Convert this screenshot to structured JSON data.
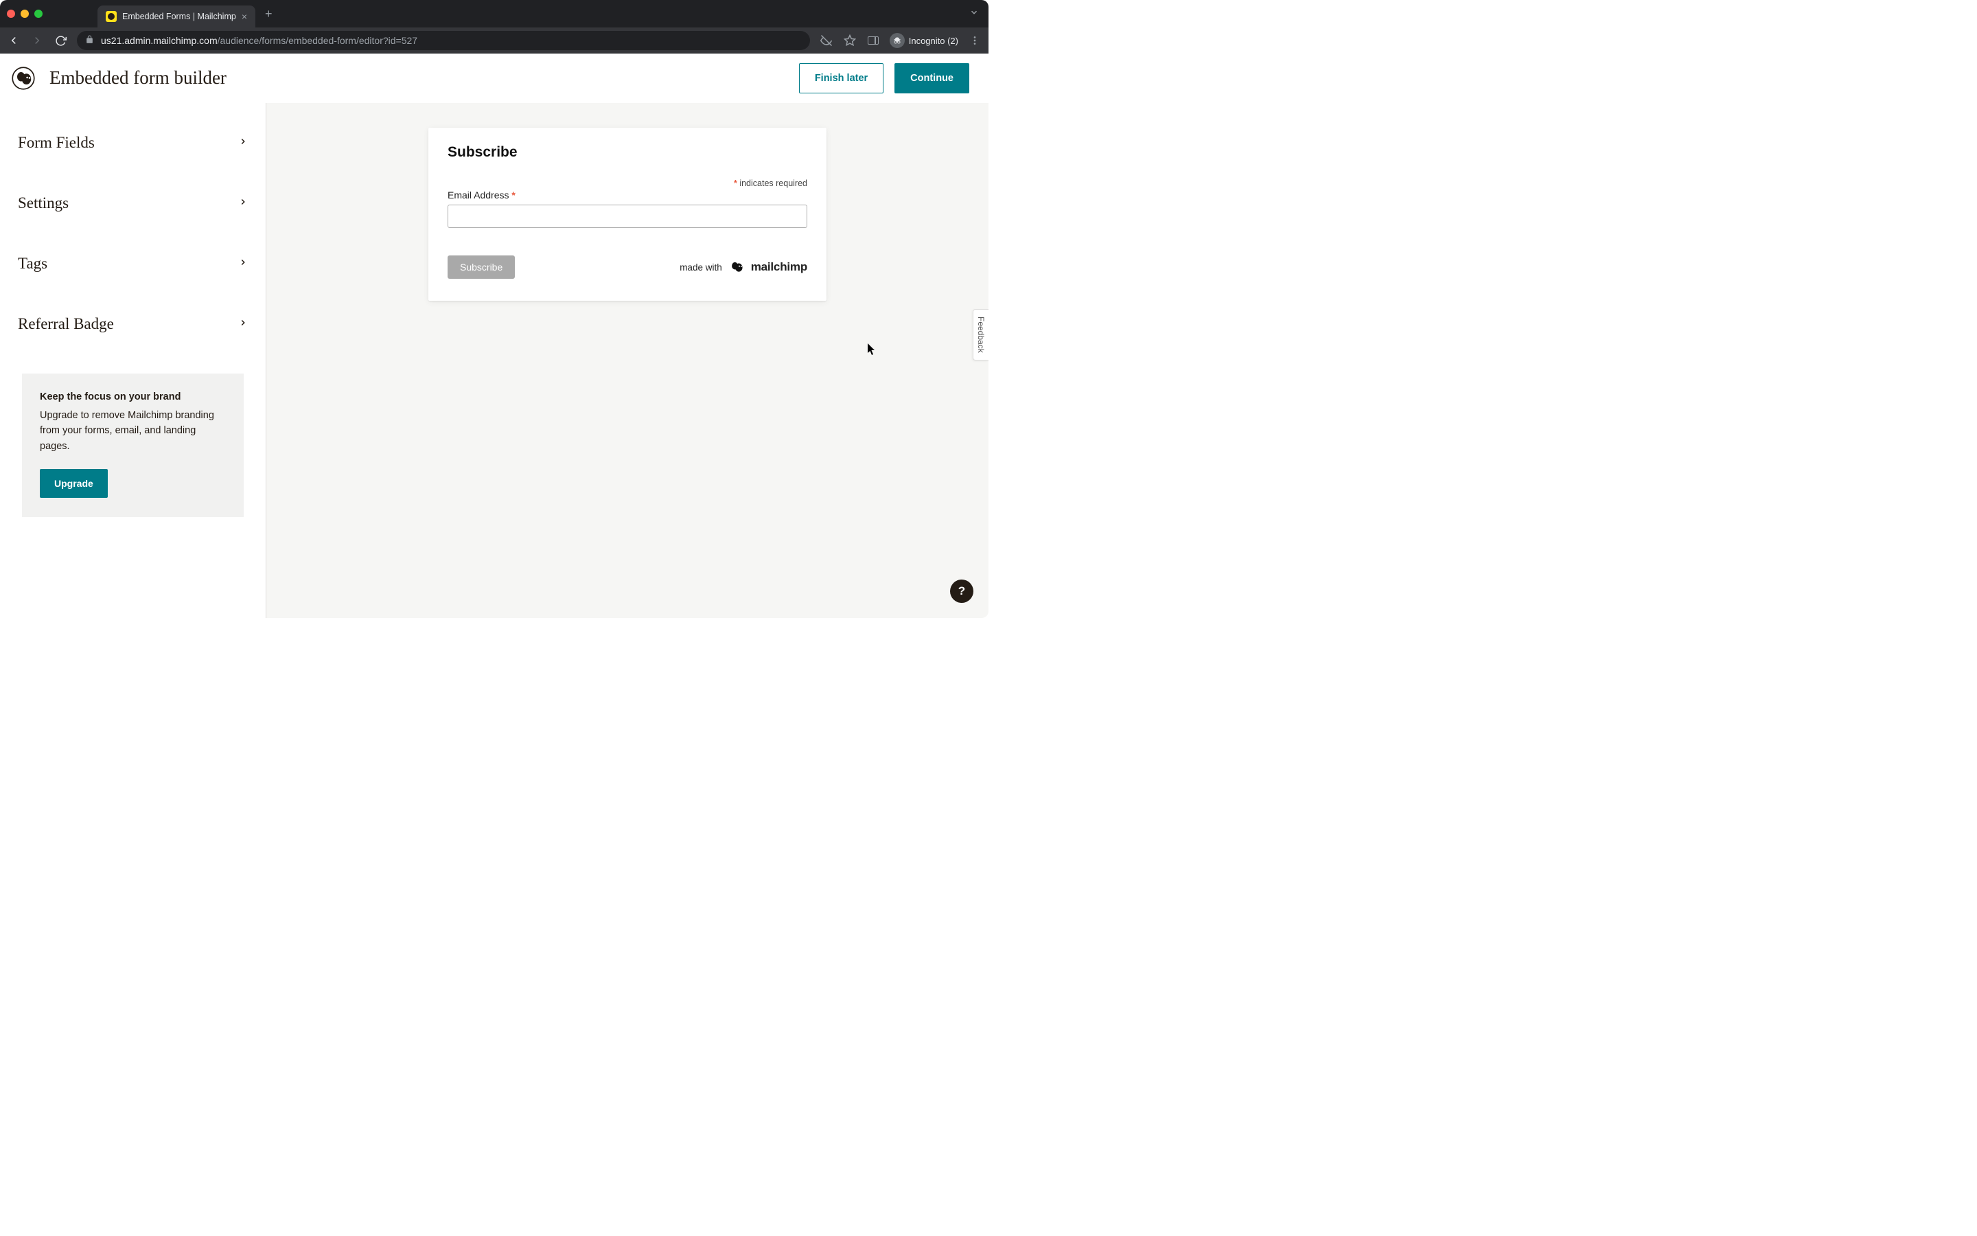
{
  "browser": {
    "tab_title": "Embedded Forms | Mailchimp",
    "url_host": "us21.admin.mailchimp.com",
    "url_path": "/audience/forms/embedded-form/editor?id=527",
    "incognito_label": "Incognito (2)"
  },
  "header": {
    "title": "Embedded form builder",
    "finish_later": "Finish later",
    "continue": "Continue"
  },
  "sidebar": {
    "items": [
      {
        "label": "Form Fields"
      },
      {
        "label": "Settings"
      },
      {
        "label": "Tags"
      },
      {
        "label": "Referral Badge"
      }
    ],
    "upsell": {
      "title": "Keep the focus on your brand",
      "body": "Upgrade to remove Mailchimp branding from your forms, email, and landing pages.",
      "cta": "Upgrade"
    }
  },
  "preview": {
    "title": "Subscribe",
    "required_note": "indicates required",
    "email_label": "Email Address",
    "email_value": "",
    "subscribe_btn": "Subscribe",
    "made_with": "made with",
    "brand": "mailchimp"
  },
  "misc": {
    "feedback": "Feedback",
    "help": "?"
  }
}
